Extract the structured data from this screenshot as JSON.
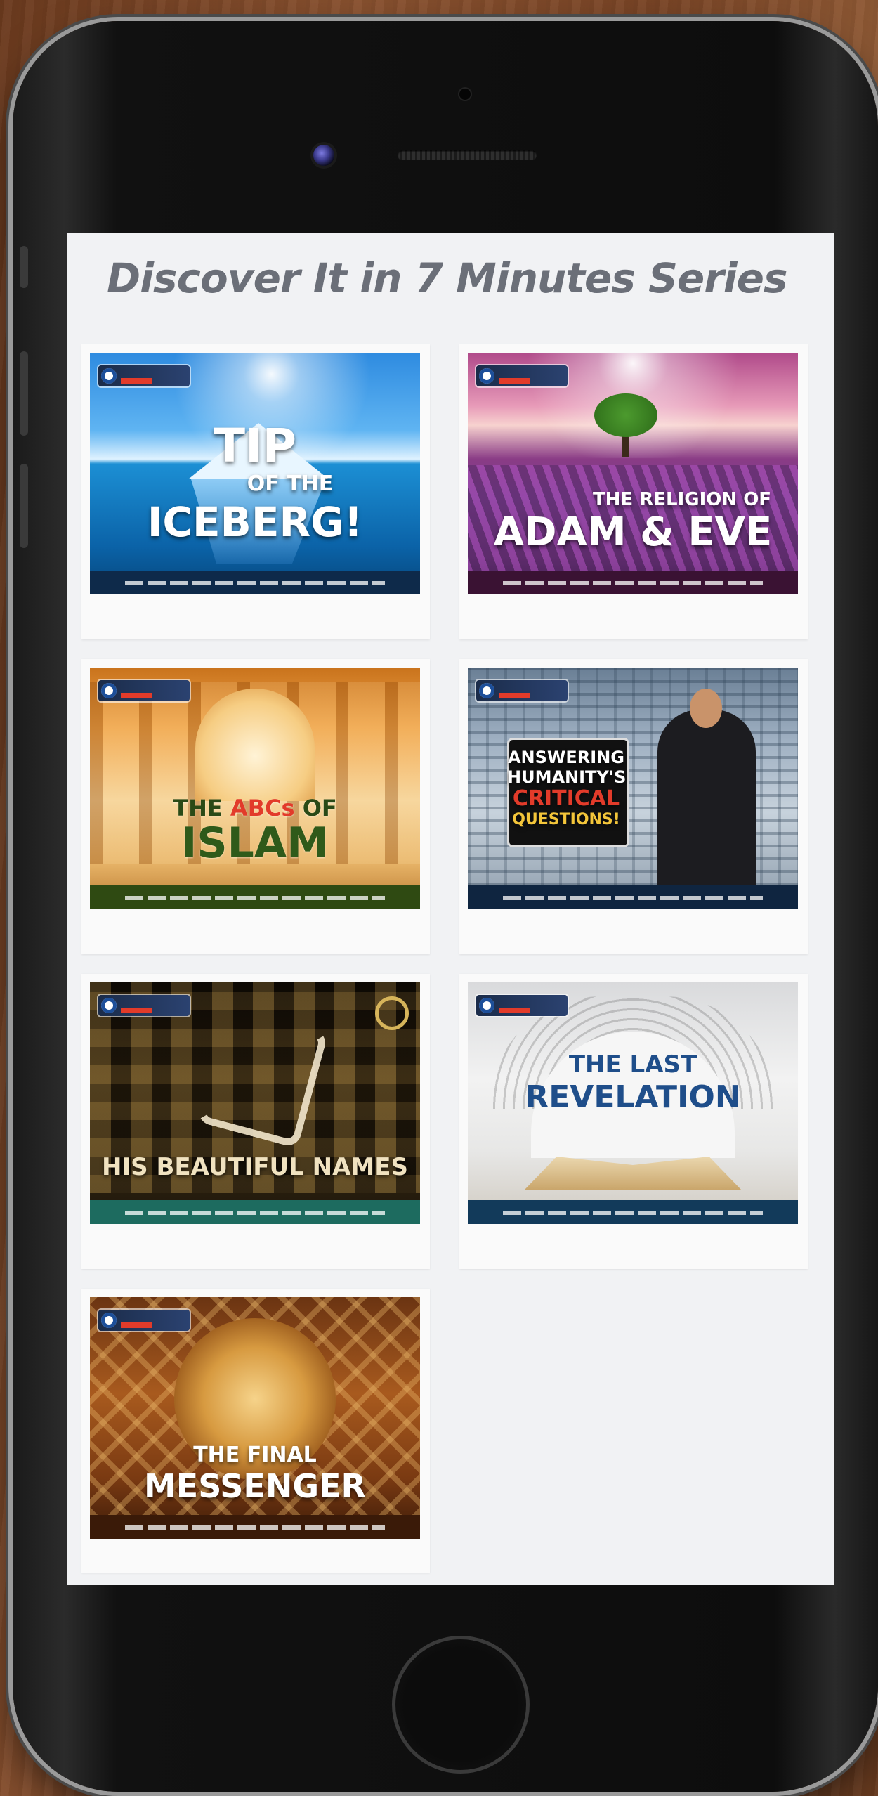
{
  "page": {
    "title": "Discover It in 7 Minutes Series"
  },
  "cards": [
    {
      "title_lines": [
        "TIP",
        "OF THE",
        "ICEBERG!"
      ]
    },
    {
      "title_lines": [
        "THE RELIGION OF",
        "ADAM & EVE"
      ]
    },
    {
      "title_lines": [
        "THE ",
        "ABCs",
        " OF",
        "ISLAM"
      ]
    },
    {
      "title_lines": [
        "ANSWERING",
        "HUMANITY'S",
        "CRITICAL",
        "QUESTIONS!"
      ]
    },
    {
      "title_lines": [
        "HIS BEAUTIFUL NAMES"
      ]
    },
    {
      "title_lines": [
        "THE LAST",
        "REVELATION"
      ]
    },
    {
      "title_lines": [
        "THE FINAL",
        "MESSENGER"
      ]
    }
  ],
  "colors": {
    "title_text": "#6b6f78",
    "screen_bg": "#f1f2f4",
    "accent_red": "#e23b2a"
  }
}
